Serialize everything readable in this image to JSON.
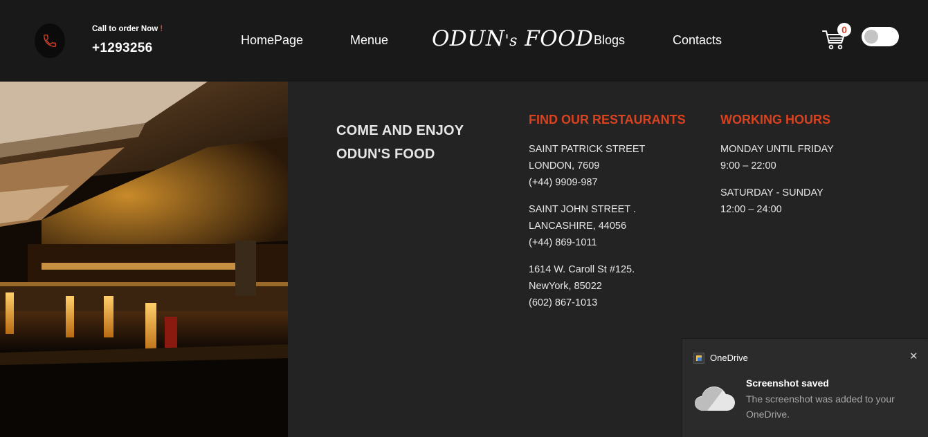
{
  "header": {
    "call_label": "Call to order Now",
    "call_excl": "!",
    "phone_number": "+1293256",
    "nav": [
      "HomePage",
      "Menue",
      "Blogs",
      "Contacts"
    ],
    "logo_main": "ODUN",
    "logo_small": "'s",
    "logo_tail": "FOOD",
    "cart_count": "0",
    "theme_toggle_on": false,
    "icons": [
      "phone-icon",
      "cart-icon"
    ]
  },
  "hero": {
    "enjoy_line1": "COME AND ENJOY",
    "enjoy_line2": "ODUN'S FOOD"
  },
  "restaurants": {
    "title": "FIND OUR RESTAURANTS",
    "locations": [
      [
        "SAINT PATRICK STREET",
        "LONDON, 7609",
        "(+44) 9909-987"
      ],
      [
        "SAINT JOHN STREET .",
        "LANCASHIRE, 44056",
        "(+44) 869-1011"
      ],
      [
        "1614 W. Caroll St #125.",
        "NewYork, 85022",
        "(602) 867-1013"
      ]
    ]
  },
  "hours": {
    "title": "WORKING HOURS",
    "blocks": [
      [
        "MONDAY UNTIL FRIDAY",
        "9:00 – 22:00"
      ],
      [
        "SATURDAY - SUNDAY",
        "12:00 – 24:00"
      ]
    ]
  },
  "toast": {
    "app": "OneDrive",
    "title": "Screenshot saved",
    "body": "The screenshot was added to your OneDrive.",
    "close": "✕"
  },
  "colors": {
    "accent": "#d9421f",
    "header_bg": "#191919",
    "page_bg": "#232323"
  }
}
